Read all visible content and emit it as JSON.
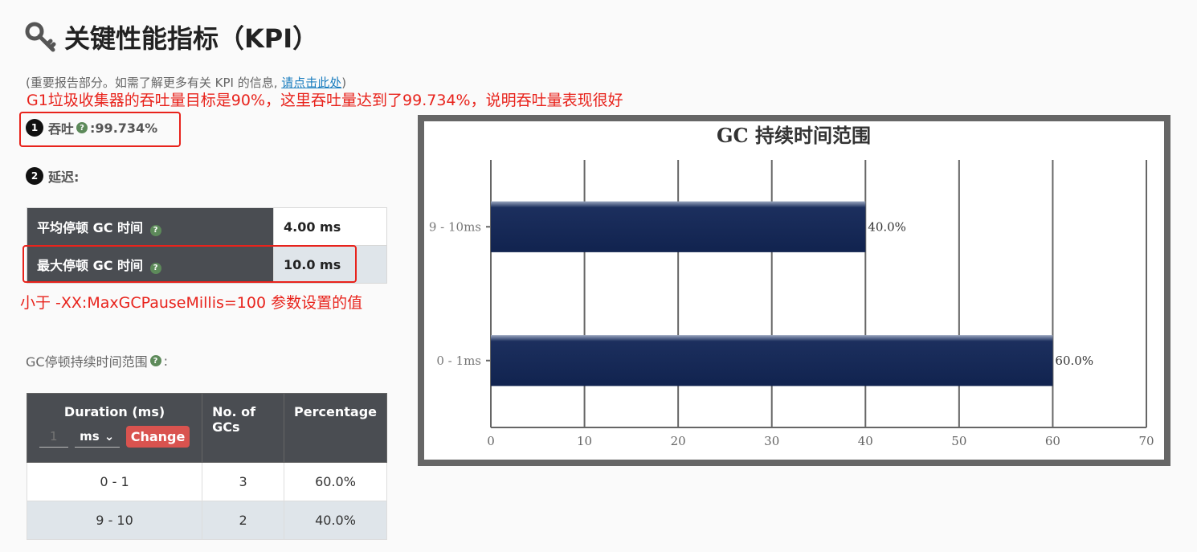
{
  "header": {
    "title": "关键性能指标（KPI）",
    "subtitle_prefix": "(重要报告部分。如需了解更多有关 KPI 的信息, ",
    "subtitle_link": "请点击此处",
    "subtitle_suffix": ")"
  },
  "annotations": {
    "g1_note": "G1垃圾收集器的吞吐量目标是90%，这里吞吐量达到了99.734%，说明吞吐量表现很好",
    "max_pause_note": "小于 -XX:MaxGCPauseMillis=100 参数设置的值"
  },
  "throughput": {
    "number": "1",
    "label": "吞吐",
    "separator": " : ",
    "value": "99.734%"
  },
  "latency": {
    "number": "2",
    "label": "延迟:"
  },
  "latency_table": [
    {
      "label": "平均停顿 GC 时间",
      "value": "4.00 ms"
    },
    {
      "label": "最大停顿 GC 时间",
      "value": "10.0 ms"
    }
  ],
  "range_section": {
    "label": "GC停顿持续时间范围",
    "suffix": ":"
  },
  "duration_table": {
    "headers": [
      "Duration (ms)",
      "No. of GCs",
      "Percentage"
    ],
    "input_placeholder": "1",
    "unit": "ms",
    "unit_caret": "⌄",
    "change_label": "Change",
    "rows": [
      {
        "range": "0 - 1",
        "count": "3",
        "percent": "60.0%"
      },
      {
        "range": "9 - 10",
        "count": "2",
        "percent": "40.0%"
      }
    ]
  },
  "chart_data": {
    "type": "bar",
    "orientation": "horizontal",
    "title": "GC 持续时间范围",
    "categories": [
      "9 - 10ms",
      "0 - 1ms"
    ],
    "values": [
      40.0,
      60.0
    ],
    "data_labels": [
      "40.0%",
      "60.0%"
    ],
    "xlim": [
      0,
      70
    ],
    "xticks": [
      0,
      10,
      20,
      30,
      40,
      50,
      60,
      70
    ],
    "bar_color": "#11234f",
    "grid": true
  },
  "colors": {
    "annotation_red": "#e8231c",
    "header_dark": "#4a4d52",
    "link": "#1a7dbf",
    "change_button": "#d9534f"
  },
  "icons": {
    "title_icon": "key-icon",
    "help_icon": "question-circle-icon"
  }
}
